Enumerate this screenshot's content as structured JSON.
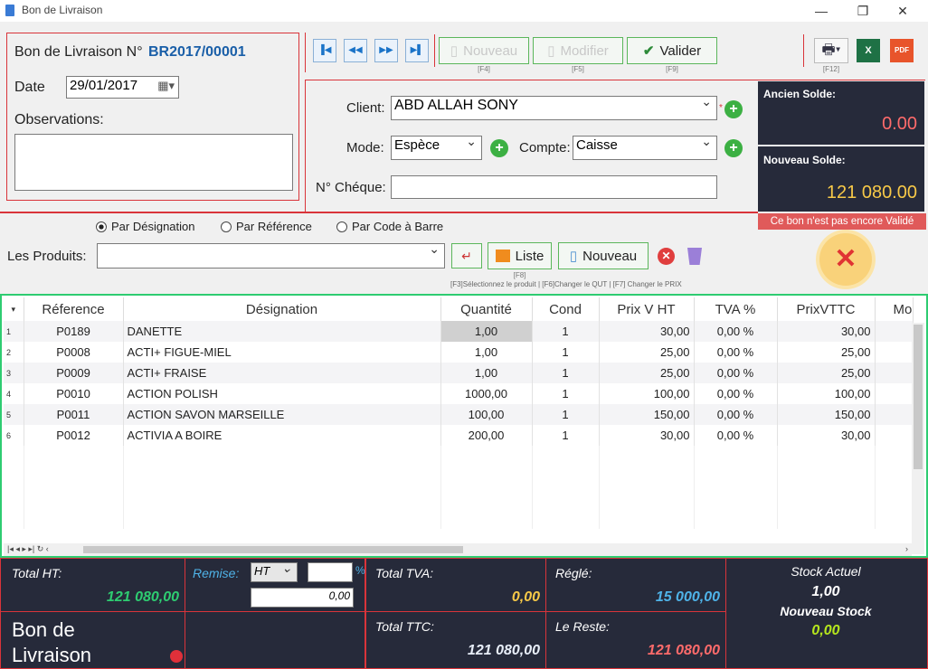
{
  "window": {
    "title": "Bon de Livraison",
    "minimize": "—",
    "maximize": "❐",
    "close": "✕"
  },
  "header": {
    "doc_label": "Bon de Livraison N°",
    "doc_number": "BR2017/00001",
    "date_label": "Date",
    "date_value": "29/01/2017",
    "obs_label": "Observations:",
    "obs_value": ""
  },
  "toolbar": {
    "new_label": "Nouveau",
    "new_key": "[F4]",
    "edit_label": "Modifier",
    "edit_key": "[F5]",
    "validate_label": "Valider",
    "validate_key": "[F9]",
    "print_key": "[F12]"
  },
  "client": {
    "client_label": "Client:",
    "client_value": "ABD ALLAH SONY",
    "mode_label": "Mode:",
    "mode_value": "Espèce",
    "account_label": "Compte:",
    "account_value": "Caisse",
    "cheque_label": "N° Chéque:",
    "cheque_value": ""
  },
  "balance": {
    "old_label": "Ancien Solde:",
    "old_value": "0.00",
    "new_label": "Nouveau Solde:",
    "new_value": "121 080.00",
    "warning": "Ce bon n'est pas encore Validé"
  },
  "search": {
    "opt1": "Par Désignation",
    "opt2": "Par Référence",
    "opt3": "Par Code à Barre",
    "products_label": "Les Produits:",
    "list_label": "Liste",
    "list_key": "[F8]",
    "new_label": "Nouveau",
    "hint": "[F3]Sélectionnez le produit | [F6]Changer le QUT | [F7] Changer le PRIX"
  },
  "table": {
    "headers": [
      "Réference",
      "Désignation",
      "Quantité",
      "Cond",
      "Prix V HT",
      "TVA %",
      "PrixVTTC",
      "Mo"
    ],
    "rows": [
      {
        "n": "1",
        "ref": "P0189",
        "des": "DANETTE",
        "qty": "1,00",
        "cond": "1",
        "pht": "30,00",
        "tva": "0,00 %",
        "pttc": "30,00"
      },
      {
        "n": "2",
        "ref": "P0008",
        "des": "ACTI+ FIGUE-MIEL",
        "qty": "1,00",
        "cond": "1",
        "pht": "25,00",
        "tva": "0,00 %",
        "pttc": "25,00"
      },
      {
        "n": "3",
        "ref": "P0009",
        "des": "ACTI+ FRAISE",
        "qty": "1,00",
        "cond": "1",
        "pht": "25,00",
        "tva": "0,00 %",
        "pttc": "25,00"
      },
      {
        "n": "4",
        "ref": "P0010",
        "des": "ACTION POLISH",
        "qty": "1000,00",
        "cond": "1",
        "pht": "100,00",
        "tva": "0,00 %",
        "pttc": "100,00"
      },
      {
        "n": "5",
        "ref": "P0011",
        "des": "ACTION SAVON MARSEILLE",
        "qty": "100,00",
        "cond": "1",
        "pht": "150,00",
        "tva": "0,00 %",
        "pttc": "150,00"
      },
      {
        "n": "6",
        "ref": "P0012",
        "des": "ACTIVIA A BOIRE",
        "qty": "200,00",
        "cond": "1",
        "pht": "30,00",
        "tva": "0,00 %",
        "pttc": "30,00"
      }
    ]
  },
  "totals": {
    "ht_label": "Total HT:",
    "ht_value": "121 080,00",
    "remise_label": "Remise:",
    "remise_type": "HT",
    "remise_pct_sign": "%",
    "remise_value": "0,00",
    "tva_label": "Total TVA:",
    "tva_value": "0,00",
    "regle_label": "Réglé:",
    "regle_value": "15 000,00",
    "ttc_label": "Total TTC:",
    "ttc_value": "121 080,00",
    "reste_label": "Le Reste:",
    "reste_value": "121 080,00",
    "doc_type": "Bon de Livraison",
    "stock_label": "Stock Actuel",
    "stock_value": "1,00",
    "new_stock_label": "Nouveau Stock",
    "new_stock_value": "0,00"
  },
  "colors": {
    "accent_red": "#d9343a",
    "green": "#2ecc71",
    "dark": "#262a3a",
    "blue": "#1a5fa8"
  }
}
